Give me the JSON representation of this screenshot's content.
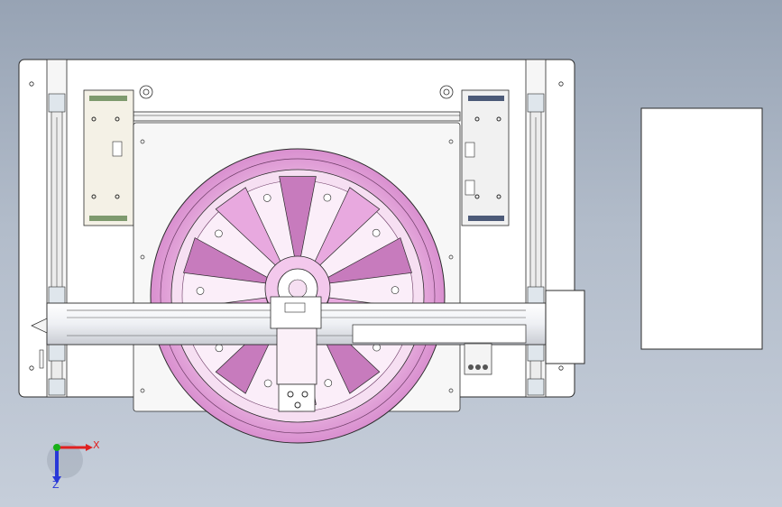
{
  "view": {
    "background_top": "#97a3b4",
    "background_bottom": "#c6ceda",
    "line_color": "#2b2b2b",
    "part_color": "#e8a9df",
    "part_shadow": "#c77bbd"
  },
  "triad": {
    "x_label": "X",
    "z_label": "Z",
    "x_color": "#e02020",
    "y_color": "#18b018",
    "z_color": "#2838d8"
  }
}
